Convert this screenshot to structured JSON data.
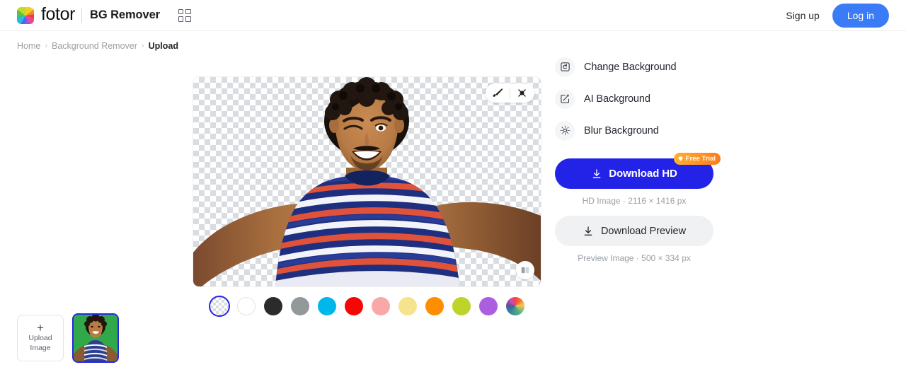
{
  "header": {
    "logo_text": "fotor",
    "logo_icon": "fotor-colorwheel-logo",
    "app_title": "BG Remover",
    "apps_grid_icon": "grid-apps-icon",
    "sign_up_label": "Sign up",
    "log_in_label": "Log in",
    "login_color": "#3b7cf6"
  },
  "breadcrumb": {
    "items": [
      {
        "label": "Home",
        "current": false
      },
      {
        "label": "Background Remover",
        "current": false
      },
      {
        "label": "Upload",
        "current": true
      }
    ],
    "separator": "›"
  },
  "canvas": {
    "tools": [
      {
        "name": "brush-icon",
        "label": "Brush"
      },
      {
        "name": "erase-icon",
        "label": "Erase"
      }
    ],
    "compare_icon": "compare-split-icon",
    "background": "transparent-checkerboard",
    "subject_alt": "Man with curly hair smiling, wearing striped t-shirt, taking selfie"
  },
  "swatches": [
    {
      "name": "transparent",
      "color": "transparent",
      "selected": true
    },
    {
      "name": "white",
      "color": "#ffffff",
      "selected": false
    },
    {
      "name": "black",
      "color": "#2b2b2b",
      "selected": false
    },
    {
      "name": "gray",
      "color": "#93999b",
      "selected": false
    },
    {
      "name": "cyan",
      "color": "#00b7ec",
      "selected": false
    },
    {
      "name": "red",
      "color": "#f90505",
      "selected": false
    },
    {
      "name": "pink",
      "color": "#f9a8a8",
      "selected": false
    },
    {
      "name": "light-yellow",
      "color": "#f6e38d",
      "selected": false
    },
    {
      "name": "orange",
      "color": "#fe8e00",
      "selected": false
    },
    {
      "name": "yellow-green",
      "color": "#bed42b",
      "selected": false
    },
    {
      "name": "purple",
      "color": "#ab5ee0",
      "selected": false
    },
    {
      "name": "custom-color-wheel",
      "color": "rainbow",
      "selected": false
    }
  ],
  "panel": {
    "options": [
      {
        "label": "Change Background",
        "icon": "change-background-icon"
      },
      {
        "label": "AI Background",
        "icon": "ai-background-icon"
      },
      {
        "label": "Blur Background",
        "icon": "blur-background-icon"
      }
    ],
    "download_hd": {
      "label": "Download HD",
      "icon": "download-icon",
      "badge": "Free Trial",
      "badge_icon": "gem-icon",
      "color": "#2323e8",
      "caption": "HD Image · 2116 × 1416 px"
    },
    "download_preview": {
      "label": "Download Preview",
      "icon": "download-icon",
      "caption": "Preview Image · 500 × 334 px"
    }
  },
  "thumbnails": {
    "upload": {
      "plus": "+",
      "line1": "Upload",
      "line2": "Image"
    },
    "items": [
      {
        "name": "uploaded-photo-thumb",
        "selected": true,
        "alt": "Man on green background"
      }
    ]
  }
}
